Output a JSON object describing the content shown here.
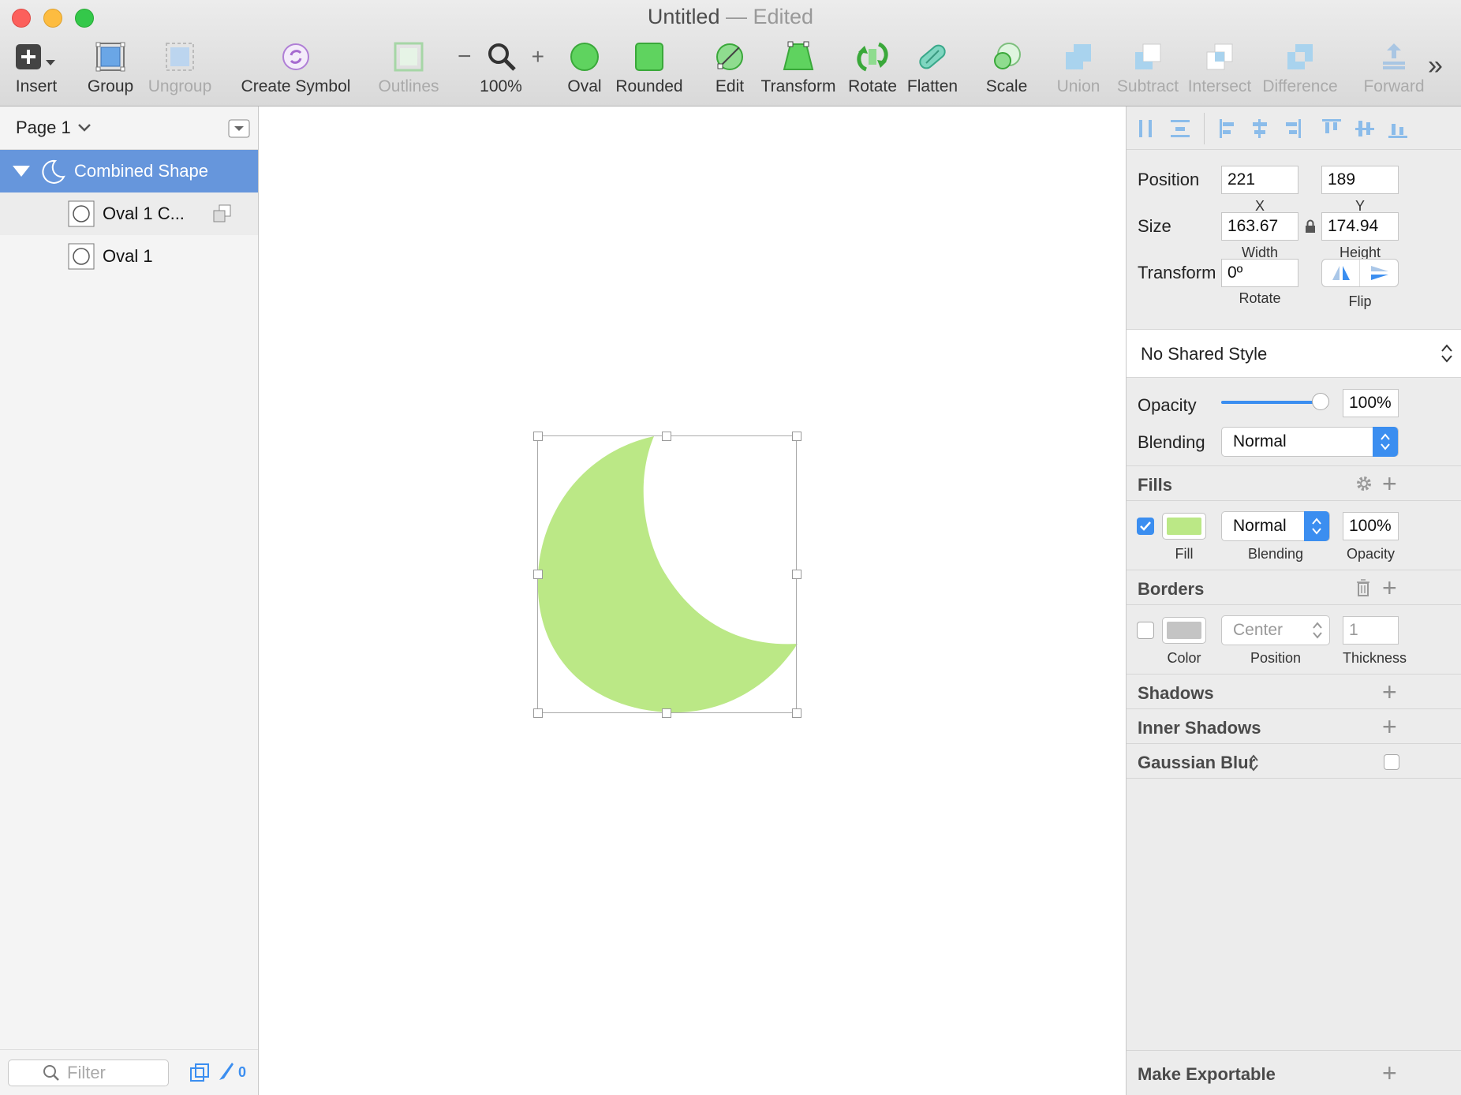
{
  "window": {
    "title": "Untitled",
    "separator": "—",
    "status": "Edited"
  },
  "toolbar": {
    "insert": "Insert",
    "group": "Group",
    "ungroup": "Ungroup",
    "create_symbol": "Create Symbol",
    "outlines": "Outlines",
    "zoom_minus": "−",
    "zoom_plus": "+",
    "zoom": "100%",
    "oval": "Oval",
    "rounded": "Rounded",
    "edit": "Edit",
    "transform": "Transform",
    "rotate": "Rotate",
    "flatten": "Flatten",
    "scale": "Scale",
    "union": "Union",
    "subtract": "Subtract",
    "intersect": "Intersect",
    "difference": "Difference",
    "forward": "Forward",
    "more": "»"
  },
  "layers": {
    "page": "Page 1",
    "items": [
      {
        "name": "Combined Shape"
      },
      {
        "name": "Oval 1 C..."
      },
      {
        "name": "Oval 1"
      }
    ],
    "filter_placeholder": "Filter",
    "badge": "0"
  },
  "inspector": {
    "position_label": "Position",
    "x": "221",
    "x_label": "X",
    "y": "189",
    "y_label": "Y",
    "size_label": "Size",
    "width": "163.67",
    "width_label": "Width",
    "height": "174.94",
    "height_label": "Height",
    "transform_label": "Transform",
    "rotate": "0º",
    "rotate_label": "Rotate",
    "flip_label": "Flip",
    "shared_style": "No Shared Style",
    "opacity_label": "Opacity",
    "opacity": "100%",
    "opacity_fraction": 1.0,
    "blending_label": "Blending",
    "blending": "Normal",
    "fills": {
      "title": "Fills",
      "enabled": true,
      "color": "#bbe886",
      "blending": "Normal",
      "opacity": "100%",
      "fill_label": "Fill",
      "blending_label": "Blending",
      "opacity_label": "Opacity"
    },
    "borders": {
      "title": "Borders",
      "enabled": false,
      "color": "#c4c4c4",
      "position": "Center",
      "thickness": "1",
      "color_label": "Color",
      "position_label": "Position",
      "thickness_label": "Thickness"
    },
    "shadows": "Shadows",
    "inner_shadows": "Inner Shadows",
    "gaussian_blur": "Gaussian Blur",
    "make_exportable": "Make Exportable"
  },
  "colors": {
    "accent": "#3b8ef0",
    "selection": "#6696dc",
    "shape": "#bbe886"
  }
}
